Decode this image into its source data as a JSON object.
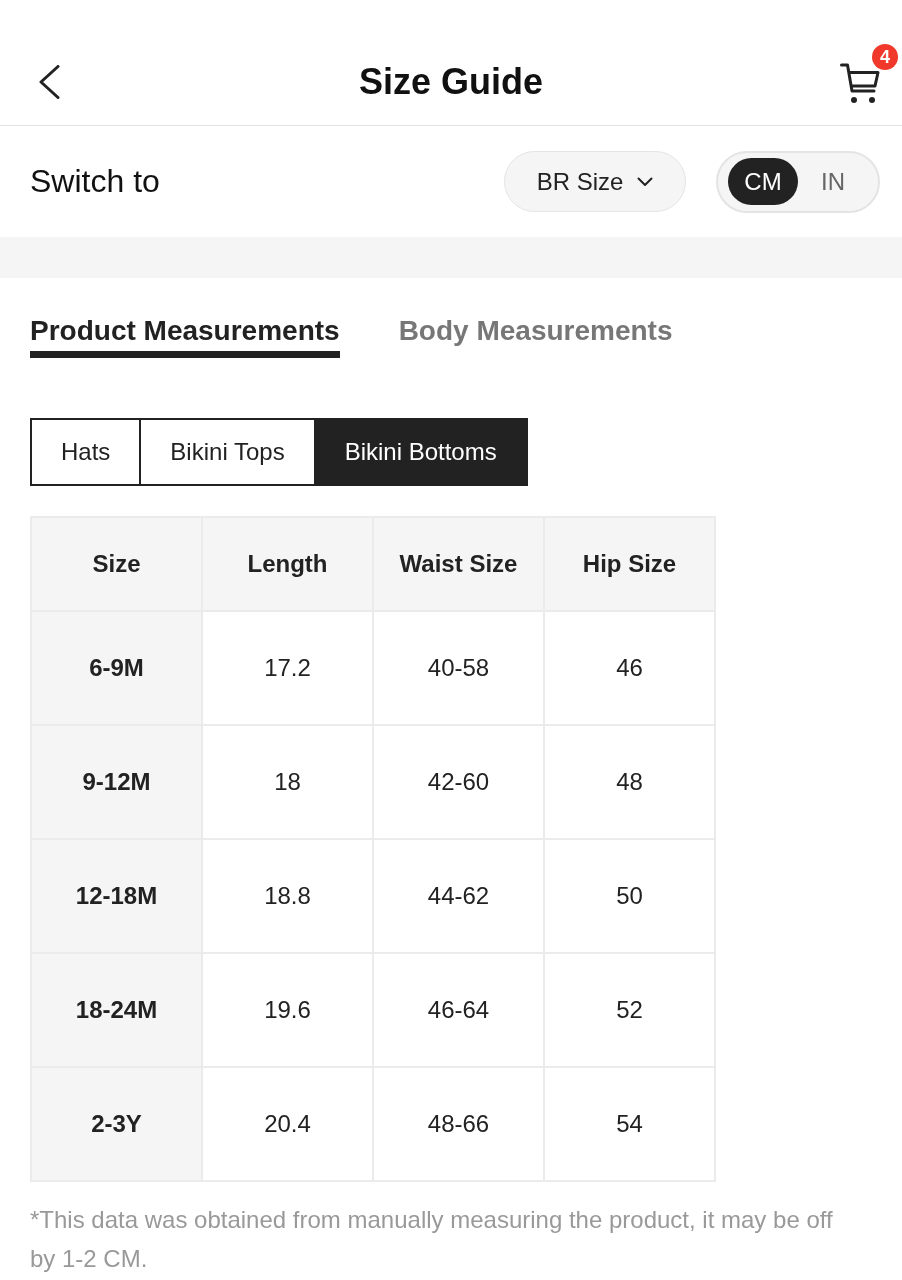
{
  "header": {
    "title": "Size Guide",
    "cart_count": "4"
  },
  "switch_bar": {
    "label": "Switch to",
    "size_system": "BR Size",
    "units": [
      {
        "label": "CM",
        "selected": true
      },
      {
        "label": "IN",
        "selected": false
      }
    ]
  },
  "tabs": [
    {
      "label": "Product Measurements",
      "selected": true
    },
    {
      "label": "Body Measurements",
      "selected": false
    }
  ],
  "categories": [
    {
      "label": "Hats",
      "selected": false
    },
    {
      "label": "Bikini Tops",
      "selected": false
    },
    {
      "label": "Bikini Bottoms",
      "selected": true
    }
  ],
  "table": {
    "columns": [
      "Size",
      "Length",
      "Waist Size",
      "Hip Size"
    ],
    "rows": [
      [
        "6-9M",
        "17.2",
        "40-58",
        "46"
      ],
      [
        "9-12M",
        "18",
        "42-60",
        "48"
      ],
      [
        "12-18M",
        "18.8",
        "44-62",
        "50"
      ],
      [
        "18-24M",
        "19.6",
        "46-64",
        "52"
      ],
      [
        "2-3Y",
        "20.4",
        "48-66",
        "54"
      ]
    ]
  },
  "footnote": "*This data was obtained from manually measuring the product, it may be off by 1-2 CM."
}
